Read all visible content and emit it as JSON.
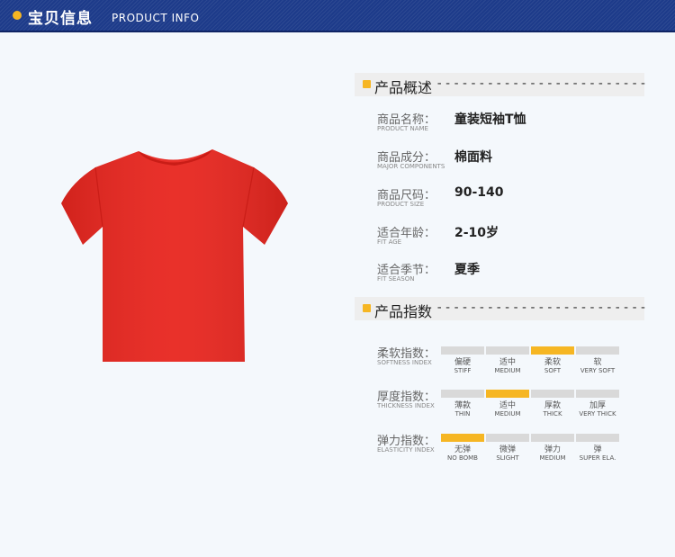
{
  "header": {
    "title_cn": "宝贝信息",
    "title_en": "PRODUCT INFO"
  },
  "overview": {
    "title": "产品概述",
    "dashes": "-------------------------",
    "rows": [
      {
        "label": "商品名称：",
        "sub": "PRODUCT NAME",
        "value": "童装短袖T恤"
      },
      {
        "label": "商品成分：",
        "sub": "MAJOR COMPONENTS",
        "value": "棉面料"
      },
      {
        "label": "商品尺码：",
        "sub": "PRODUCT SIZE",
        "value": "90-140"
      },
      {
        "label": "适合年龄：",
        "sub": "FIT AGE",
        "value": "2-10岁"
      },
      {
        "label": "适合季节：",
        "sub": "FIT SEASON",
        "value": "夏季"
      }
    ]
  },
  "index": {
    "title": "产品指数",
    "dashes": "-------------------------",
    "rows": [
      {
        "label": "柔软指数：",
        "sub": "SOFTNESS INDEX",
        "level": 3,
        "options": [
          {
            "cn": "偏硬",
            "en": "STIFF"
          },
          {
            "cn": "适中",
            "en": "MEDIUM"
          },
          {
            "cn": "柔软",
            "en": "SOFT"
          },
          {
            "cn": "软",
            "en": "VERY SOFT"
          }
        ]
      },
      {
        "label": "厚度指数：",
        "sub": "THICKNESS INDEX",
        "level": 2,
        "options": [
          {
            "cn": "薄款",
            "en": "THIN"
          },
          {
            "cn": "适中",
            "en": "MEDIUM"
          },
          {
            "cn": "厚款",
            "en": "THICK"
          },
          {
            "cn": "加厚",
            "en": "VERY THICK"
          }
        ]
      },
      {
        "label": "弹力指数：",
        "sub": "ELASTICITY INDEX",
        "level": 1,
        "options": [
          {
            "cn": "无弹",
            "en": "NO BOMB"
          },
          {
            "cn": "微弹",
            "en": "SLIGHT"
          },
          {
            "cn": "弹力",
            "en": "MEDIUM"
          },
          {
            "cn": "弹",
            "en": "SUPER ELA."
          }
        ]
      }
    ]
  },
  "colors": {
    "header_bg": "#1d3b8a",
    "accent": "#f6b623",
    "shirt": "#e8261f",
    "segment_off": "#d9d9d9"
  },
  "icons": {
    "header": "bullet-dot-icon",
    "section": "square-bullet-icon"
  }
}
